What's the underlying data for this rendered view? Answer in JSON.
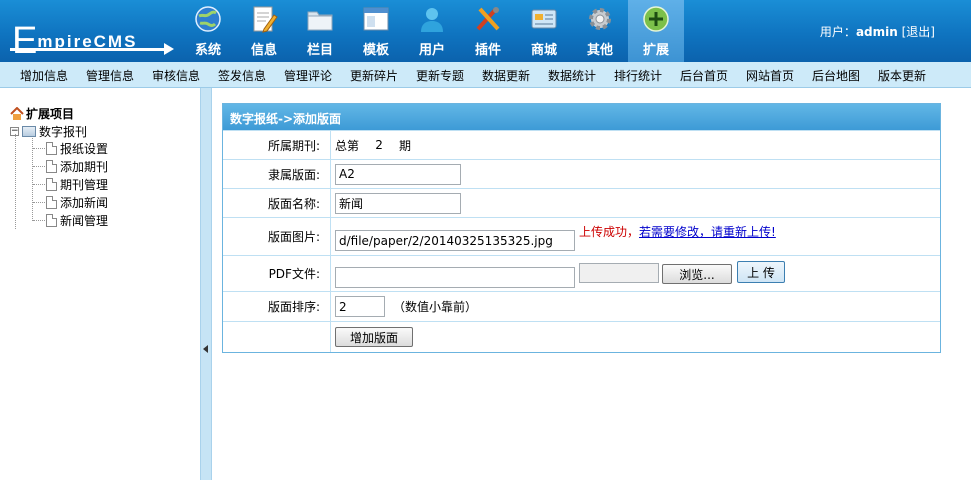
{
  "logo": {
    "first": "E",
    "rest": "mpireCMS"
  },
  "nav": [
    {
      "label": "系统",
      "icon": "globe-icon"
    },
    {
      "label": "信息",
      "icon": "document-pencil-icon"
    },
    {
      "label": "栏目",
      "icon": "folder-icon"
    },
    {
      "label": "模板",
      "icon": "window-icon"
    },
    {
      "label": "用户",
      "icon": "user-icon"
    },
    {
      "label": "插件",
      "icon": "tools-icon"
    },
    {
      "label": "商城",
      "icon": "card-icon"
    },
    {
      "label": "其他",
      "icon": "gear-icon"
    },
    {
      "label": "扩展",
      "icon": "plus-icon",
      "active": true
    }
  ],
  "user": {
    "prefix": "用户：",
    "name": "admin",
    "logout": "[退出]"
  },
  "submenu": [
    "增加信息",
    "管理信息",
    "审核信息",
    "签发信息",
    "管理评论",
    "更新碎片",
    "更新专题",
    "数据更新",
    "数据统计",
    "排行统计",
    "后台首页",
    "网站首页",
    "后台地图",
    "版本更新"
  ],
  "tree": {
    "root": "扩展项目",
    "group": "数字报刊",
    "items": [
      "报纸设置",
      "添加期刊",
      "期刊管理",
      "添加新闻",
      "新闻管理"
    ]
  },
  "form": {
    "title": "数字报纸->添加版面",
    "issue_label": "所属期刊:",
    "issue_prefix": "总第",
    "issue_number": "2",
    "issue_suffix": "期",
    "section_label": "隶属版面:",
    "section_value": "A2",
    "name_label": "版面名称:",
    "name_value": "新闻",
    "image_label": "版面图片:",
    "image_value": "d/file/paper/2/20140325135325.jpg",
    "upload_ok": "上传成功，",
    "reupload_link": "若需要修改，请重新上传!",
    "pdf_label": "PDF文件:",
    "pdf_value": "",
    "browse_label": "浏览...",
    "upload_label": "上 传",
    "order_label": "版面排序:",
    "order_value": "2",
    "order_hint": "（数值小靠前）",
    "submit_label": "增加版面"
  },
  "colors": {
    "header": "#0f74c0",
    "submenu": "#cdeaf9",
    "form_header": "#3d9ad6",
    "error_text": "#cc0000",
    "link": "#0000cc"
  }
}
